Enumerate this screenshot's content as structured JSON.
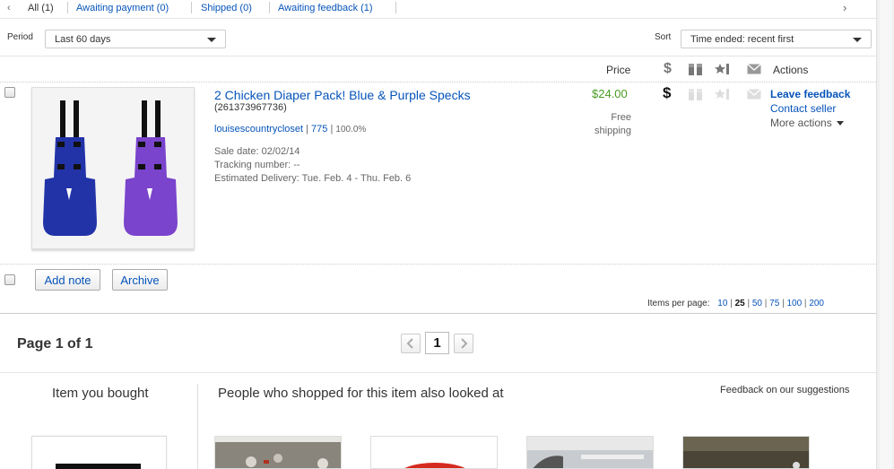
{
  "tabs": [
    {
      "label": "All (1)"
    },
    {
      "label": "Awaiting payment (0)"
    },
    {
      "label": "Shipped (0)"
    },
    {
      "label": "Awaiting feedback (1)"
    }
  ],
  "period": {
    "label": "Period",
    "value": "Last 60 days"
  },
  "sort": {
    "label": "Sort",
    "value": "Time ended: recent first"
  },
  "columns": {
    "price": "Price",
    "actions": "Actions"
  },
  "item": {
    "title": "2 Chicken Diaper Pack! Blue & Purple Specks",
    "item_number": "(261373967736)",
    "seller": "louisescountrycloset",
    "feedback_score": "775",
    "positive_pct": "100.0%",
    "sale_date": "Sale date: 02/02/14",
    "tracking": "Tracking number: --",
    "delivery": "Estimated Delivery: Tue. Feb. 4 - Thu. Feb. 6",
    "price": "$24.00",
    "shipping": "Free shipping",
    "price_color": "#4a9b22"
  },
  "actions": {
    "leave_feedback": "Leave feedback",
    "contact_seller": "Contact seller",
    "more_actions": "More actions"
  },
  "buttons": {
    "add_note": "Add note",
    "archive": "Archive"
  },
  "items_per_page": {
    "label": "Items per page:",
    "options": [
      "10",
      "25",
      "50",
      "75",
      "100",
      "200"
    ],
    "selected": "25"
  },
  "pagination": {
    "page_text": "Page 1 of 1",
    "current": "1"
  },
  "recommendations": {
    "item_you_bought": "Item you bought",
    "also_looked": "People who shopped for this item also looked at",
    "feedback_link": "Feedback on our suggestions"
  }
}
